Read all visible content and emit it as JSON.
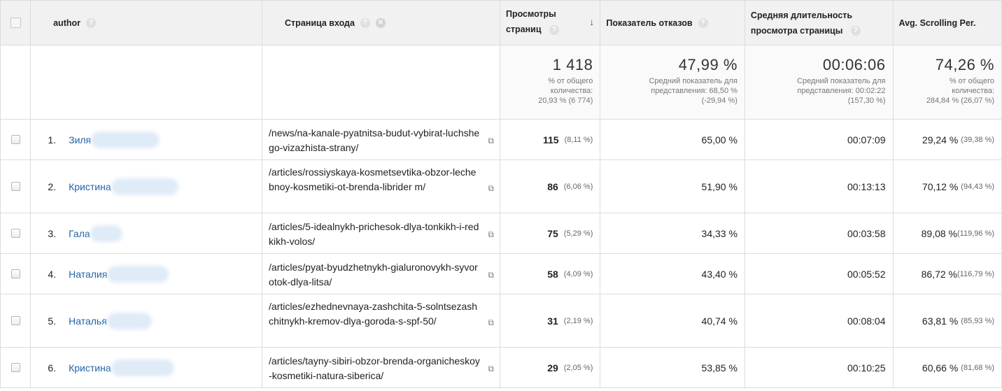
{
  "header": {
    "author": "author",
    "landing_page": "Страница входа",
    "pageviews": "Просмотры страниц",
    "bounce_rate": "Показатель отказов",
    "avg_duration": "Средняя длительность просмотра страницы",
    "avg_scroll": "Avg. Scrolling Per.",
    "help_glyph": "?",
    "remove_glyph": "✕",
    "sort_glyph": "↓",
    "ext_glyph": "⧉"
  },
  "summary": {
    "pageviews": {
      "value": "1 418",
      "note1": "% от общего",
      "note2": "количества:",
      "note3": "20,93 % (6 774)"
    },
    "bounce_rate": {
      "value": "47,99 %",
      "note1": "Средний показатель для",
      "note2": "представления: 68,50 %",
      "note3": "(-29,94 %)"
    },
    "avg_duration": {
      "value": "00:06:06",
      "note1": "Средний показатель для",
      "note2": "представления: 00:02:22",
      "note3": "(157,30 %)"
    },
    "avg_scroll": {
      "value": "74,26 %",
      "note1": "% от общего",
      "note2": "количества:",
      "note3": "284,84 % (26,07 %)"
    }
  },
  "rows": [
    {
      "num": "1.",
      "author": "Зиля",
      "page": "/news/na-kanale-pyatnitsa-budut-vybirat-luchshego-vizazhista-strany/",
      "pageviews": "115",
      "pageviews_pct": "(8,11 %)",
      "bounce": "65,00 %",
      "duration": "00:07:09",
      "scroll": "29,24 %",
      "scroll_pct": "(39,38 %)"
    },
    {
      "num": "2.",
      "author": "Кристина",
      "page": "/articles/rossiyskaya-kosmetsevtika-obzor-lechebnoy-kosmetiki-ot-brenda-librider m/",
      "pageviews": "86",
      "pageviews_pct": "(6,06 %)",
      "bounce": "51,90 %",
      "duration": "00:13:13",
      "scroll": "70,12 %",
      "scroll_pct": "(94,43 %)"
    },
    {
      "num": "3.",
      "author": "Гала",
      "page": "/articles/5-idealnykh-prichesok-dlya-tonkikh-i-redkikh-volos/",
      "pageviews": "75",
      "pageviews_pct": "(5,29 %)",
      "bounce": "34,33 %",
      "duration": "00:03:58",
      "scroll": "89,08 %",
      "scroll_pct": "(119,96 %)"
    },
    {
      "num": "4.",
      "author": "Наталия",
      "page": "/articles/pyat-byudzhetnykh-gialuronovykh-syvorotok-dlya-litsa/",
      "pageviews": "58",
      "pageviews_pct": "(4,09 %)",
      "bounce": "43,40 %",
      "duration": "00:05:52",
      "scroll": "86,72 %",
      "scroll_pct": "(116,79 %)"
    },
    {
      "num": "5.",
      "author": "Наталья",
      "page": "/articles/ezhednevnaya-zashchita-5-solntsezashchitnykh-kremov-dlya-goroda-s-spf-50/",
      "pageviews": "31",
      "pageviews_pct": "(2,19 %)",
      "bounce": "40,74 %",
      "duration": "00:08:04",
      "scroll": "63,81 %",
      "scroll_pct": "(85,93 %)"
    },
    {
      "num": "6.",
      "author": "Кристина",
      "page": "/articles/tayny-sibiri-obzor-brenda-organicheskoy-kosmetiki-natura-siberica/",
      "pageviews": "29",
      "pageviews_pct": "(2,05 %)",
      "bounce": "53,85 %",
      "duration": "00:10:25",
      "scroll": "60,66 %",
      "scroll_pct": "(81,68 %)"
    }
  ]
}
